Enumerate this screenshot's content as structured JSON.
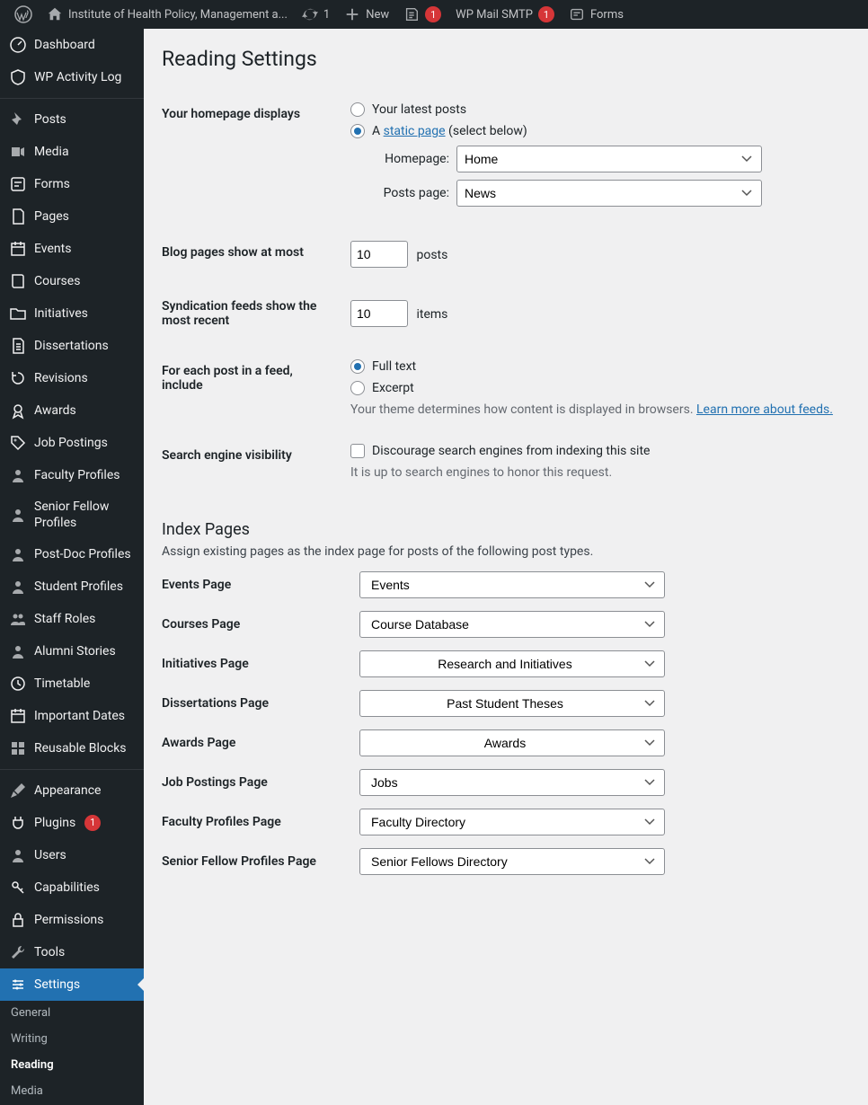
{
  "adminbar": {
    "site_name": "Institute of Health Policy, Management a...",
    "updates_count": "1",
    "new_label": "New",
    "forms_notice": "1",
    "mailsmtp_label": "WP Mail SMTP",
    "mailsmtp_count": "1",
    "forms_label": "Forms"
  },
  "sidebar": {
    "items": [
      {
        "label": "Dashboard"
      },
      {
        "label": "WP Activity Log"
      },
      {
        "label": "Posts"
      },
      {
        "label": "Media"
      },
      {
        "label": "Forms"
      },
      {
        "label": "Pages"
      },
      {
        "label": "Events"
      },
      {
        "label": "Courses"
      },
      {
        "label": "Initiatives"
      },
      {
        "label": "Dissertations"
      },
      {
        "label": "Revisions"
      },
      {
        "label": "Awards"
      },
      {
        "label": "Job Postings"
      },
      {
        "label": "Faculty Profiles"
      },
      {
        "label": "Senior Fellow Profiles"
      },
      {
        "label": "Post-Doc Profiles"
      },
      {
        "label": "Student Profiles"
      },
      {
        "label": "Staff Roles"
      },
      {
        "label": "Alumni Stories"
      },
      {
        "label": "Timetable"
      },
      {
        "label": "Important Dates"
      },
      {
        "label": "Reusable Blocks"
      },
      {
        "label": "Appearance"
      },
      {
        "label": "Plugins",
        "count": "1"
      },
      {
        "label": "Users"
      },
      {
        "label": "Capabilities"
      },
      {
        "label": "Permissions"
      },
      {
        "label": "Tools"
      },
      {
        "label": "Settings"
      }
    ],
    "submenu": [
      {
        "label": "General"
      },
      {
        "label": "Writing"
      },
      {
        "label": "Reading"
      },
      {
        "label": "Media"
      }
    ]
  },
  "page": {
    "title": "Reading Settings",
    "homepage_displays_label": "Your homepage displays",
    "option_latest": "Your latest posts",
    "option_static_prefix": "A ",
    "option_static_link": "static page",
    "option_static_suffix": " (select below)",
    "homepage_label": "Homepage:",
    "homepage_value": "Home",
    "postspage_label": "Posts page:",
    "postspage_value": "News",
    "blog_pages_label": "Blog pages show at most",
    "blog_pages_value": "10",
    "blog_pages_unit": "posts",
    "syndication_label": "Syndication feeds show the most recent",
    "syndication_value": "10",
    "syndication_unit": "items",
    "feed_include_label": "For each post in a feed, include",
    "feed_full": "Full text",
    "feed_excerpt": "Excerpt",
    "feed_desc_prefix": "Your theme determines how content is displayed in browsers. ",
    "feed_desc_link": "Learn more about feeds.",
    "search_engine_label": "Search engine visibility",
    "search_engine_checkbox": "Discourage search engines from indexing this site",
    "search_engine_desc": "It is up to search engines to honor this request.",
    "index_heading": "Index Pages",
    "index_desc": "Assign existing pages as the index page for posts of the following post types.",
    "index_rows": [
      {
        "label": "Events Page",
        "value": "Events"
      },
      {
        "label": "Courses Page",
        "value": "Course Database"
      },
      {
        "label": "Initiatives Page",
        "value": "Research and Initiatives"
      },
      {
        "label": "Dissertations Page",
        "value": "Past Student Theses"
      },
      {
        "label": "Awards Page",
        "value": "Awards"
      },
      {
        "label": "Job Postings Page",
        "value": "Jobs"
      },
      {
        "label": "Faculty Profiles Page",
        "value": "Faculty Directory"
      },
      {
        "label": "Senior Fellow Profiles Page",
        "value": "Senior Fellows Directory"
      }
    ]
  }
}
